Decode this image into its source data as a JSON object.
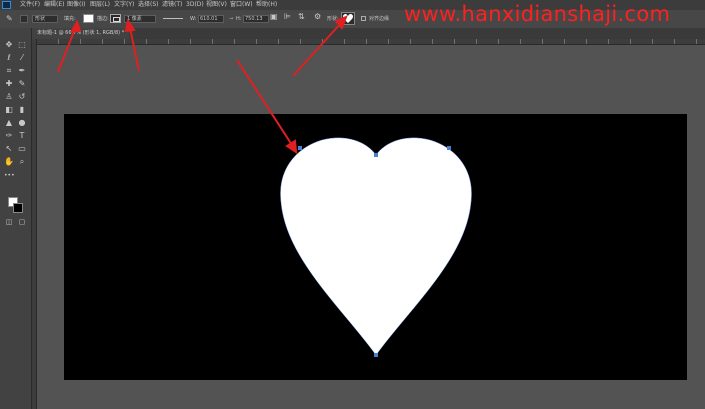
{
  "menubar": {
    "items": [
      "文件(F)",
      "编辑(E)",
      "图像(I)",
      "图层(L)",
      "文字(Y)",
      "选择(S)",
      "滤镜(T)",
      "3D(D)",
      "视图(V)",
      "窗口(W)",
      "帮助(H)"
    ]
  },
  "options": {
    "mode_label": "形状",
    "fill_label": "填充:",
    "stroke_label": "描边:",
    "stroke_width": "1 像素",
    "w_label": "W:",
    "w_value": "610.01",
    "h_label": "H:",
    "h_value": "750.13",
    "custom_shape_label": "形状:",
    "align_edges_label": "对齐边缘"
  },
  "watermark": "www.hanxidianshaji.com",
  "doc_tab": "未标题-1 @ 66.7% (形状 1, RGB/8) *",
  "colors": {
    "canvas": "#000000",
    "shape_fill": "#ffffff",
    "anchor": "#4a7fd0",
    "arrow": "#e02020",
    "workspace": "#535353",
    "watermark": "#ff2020"
  },
  "icons": {
    "ps_logo": "photoshop-logo",
    "tools": [
      "move-icon",
      "marquee-icon",
      "lasso-icon",
      "magic-wand-icon",
      "crop-icon",
      "eyedropper-icon",
      "healing-brush-icon",
      "brush-icon",
      "clone-stamp-icon",
      "history-brush-icon",
      "eraser-icon",
      "gradient-icon",
      "blur-icon",
      "dodge-icon",
      "pen-icon",
      "type-icon",
      "path-selection-icon",
      "shape-icon",
      "hand-icon",
      "zoom-icon"
    ]
  }
}
